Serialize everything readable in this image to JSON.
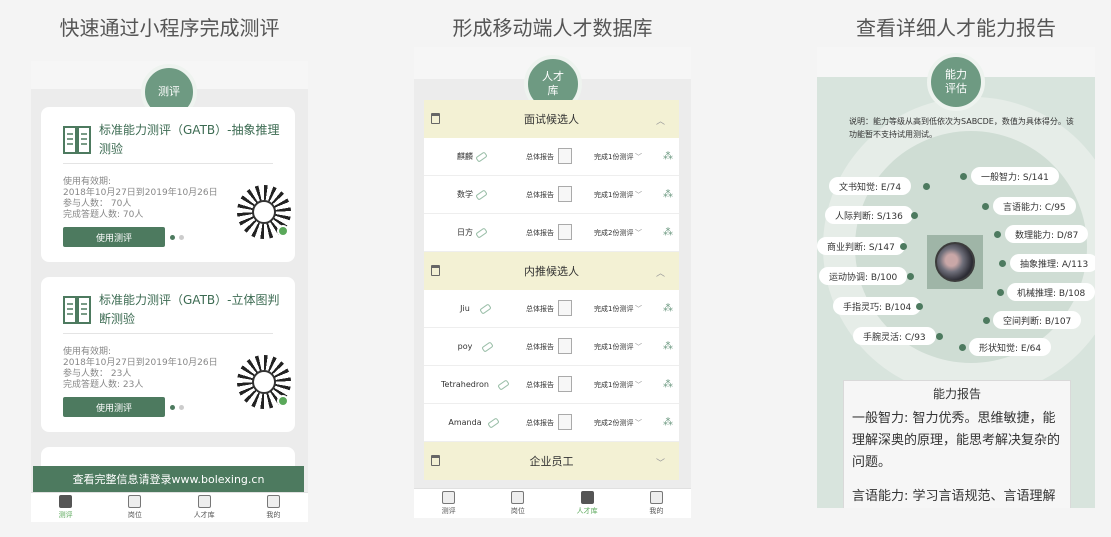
{
  "captions": [
    "快速通过小程序完成测评",
    "形成移动端人才数据库",
    "查看详细人才能力报告"
  ],
  "phone1": {
    "badge": "测评",
    "cards": [
      {
        "title": "标准能力测评（GATB）-抽象推理测验",
        "validity_label": "使用有效期:",
        "validity": "2018年10月27日到2019年10月26日",
        "participants": "参与人数：  70人",
        "completed": "完成答题人数: 70人",
        "button": "使用测评"
      },
      {
        "title": "标准能力测评（GATB）-立体图判断测验",
        "validity_label": "使用有效期:",
        "validity": "2018年10月27日到2019年10月26日",
        "participants": "参与人数：  23人",
        "completed": "完成答题人数: 23人",
        "button": "使用测评"
      }
    ],
    "banner": "查看完整信息请登录www.bolexing.cn",
    "tabs": [
      "测评",
      "岗位",
      "人才库",
      "我的"
    ]
  },
  "phone2": {
    "badge": "人才库",
    "groups": [
      {
        "name": "面试候选人",
        "rows": [
          {
            "name": "麒麟",
            "report": "总体报告",
            "status": "完成1份测评"
          },
          {
            "name": "数学",
            "report": "总体报告",
            "status": "完成1份测评"
          },
          {
            "name": "日方",
            "report": "总体报告",
            "status": "完成2份测评"
          }
        ]
      },
      {
        "name": "内推候选人",
        "rows": [
          {
            "name": "Jiu",
            "report": "总体报告",
            "status": "完成1份测评"
          },
          {
            "name": "poy",
            "report": "总体报告",
            "status": "完成1份测评"
          },
          {
            "name": "Tetrahedron",
            "report": "总体报告",
            "status": "完成1份测评"
          },
          {
            "name": "Amanda",
            "report": "总体报告",
            "status": "完成2份测评"
          }
        ]
      },
      {
        "name": "企业员工",
        "rows": []
      }
    ],
    "tabs": [
      "测评",
      "岗位",
      "人才库",
      "我的"
    ]
  },
  "phone3": {
    "badge": "能力\n评估",
    "note": "说明：能力等级从高到低依次为SABCDE，数值为具体得分。该功能暂不支持试用测试。",
    "abilities_left": [
      "文书知觉: E/74",
      "人际判断: S/136",
      "商业判断: S/147",
      "运动协调: B/100",
      "手指灵巧: B/104",
      "手腕灵活: C/93"
    ],
    "abilities_right": [
      "一般智力: S/141",
      "言语能力: C/95",
      "数理能力: D/87",
      "抽象推理: A/113",
      "机械推理: B/108",
      "空间判断: B/107",
      "形状知觉: E/64"
    ],
    "report_title": "能力报告",
    "report_p1": "一般智力: 智力优秀。思维敏捷，能理解深奥的原理，能思考解决复杂的问题。",
    "report_p2": "言语能力: 学习言语规范、言语理解和"
  }
}
